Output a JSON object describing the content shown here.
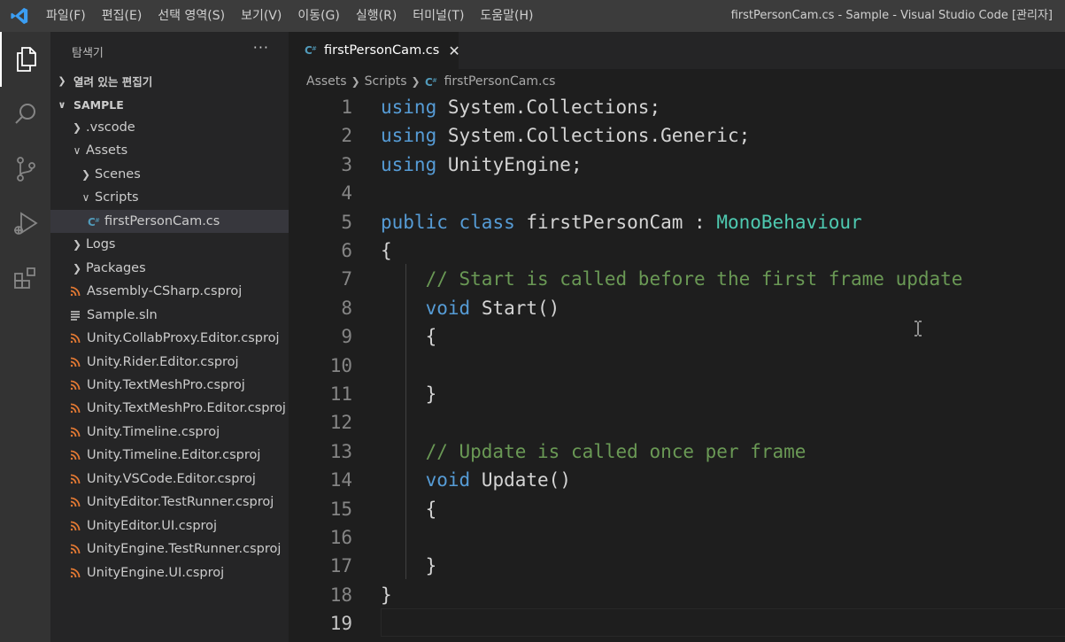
{
  "titlebar": {
    "menu": [
      "파일(F)",
      "편집(E)",
      "선택 영역(S)",
      "보기(V)",
      "이동(G)",
      "실행(R)",
      "터미널(T)",
      "도움말(H)"
    ],
    "window_title": "firstPersonCam.cs - Sample - Visual Studio Code [관리자]"
  },
  "activity_bar": {
    "icons": [
      "explorer-icon",
      "search-icon",
      "source-control-icon",
      "run-debug-icon",
      "extensions-icon"
    ],
    "active": "explorer-icon"
  },
  "sidebar": {
    "title": "탐색기",
    "more": "···",
    "open_editors_label": "열려 있는 편집기",
    "folder_label": "SAMPLE",
    "tree": [
      {
        "label": ".vscode",
        "kind": "folder",
        "expanded": false,
        "depth": 0
      },
      {
        "label": "Assets",
        "kind": "folder",
        "expanded": true,
        "depth": 0
      },
      {
        "label": "Scenes",
        "kind": "folder",
        "expanded": false,
        "depth": 1
      },
      {
        "label": "Scripts",
        "kind": "folder",
        "expanded": true,
        "depth": 1
      },
      {
        "label": "firstPersonCam.cs",
        "kind": "csharp",
        "depth": 2,
        "selected": true
      },
      {
        "label": "Logs",
        "kind": "folder",
        "expanded": false,
        "depth": 0
      },
      {
        "label": "Packages",
        "kind": "folder",
        "expanded": false,
        "depth": 0
      },
      {
        "label": "Assembly-CSharp.csproj",
        "kind": "rss",
        "depth": 0
      },
      {
        "label": "Sample.sln",
        "kind": "sln",
        "depth": 0
      },
      {
        "label": "Unity.CollabProxy.Editor.csproj",
        "kind": "rss",
        "depth": 0
      },
      {
        "label": "Unity.Rider.Editor.csproj",
        "kind": "rss",
        "depth": 0
      },
      {
        "label": "Unity.TextMeshPro.csproj",
        "kind": "rss",
        "depth": 0
      },
      {
        "label": "Unity.TextMeshPro.Editor.csproj",
        "kind": "rss",
        "depth": 0
      },
      {
        "label": "Unity.Timeline.csproj",
        "kind": "rss",
        "depth": 0
      },
      {
        "label": "Unity.Timeline.Editor.csproj",
        "kind": "rss",
        "depth": 0
      },
      {
        "label": "Unity.VSCode.Editor.csproj",
        "kind": "rss",
        "depth": 0
      },
      {
        "label": "UnityEditor.TestRunner.csproj",
        "kind": "rss",
        "depth": 0
      },
      {
        "label": "UnityEditor.UI.csproj",
        "kind": "rss",
        "depth": 0
      },
      {
        "label": "UnityEngine.TestRunner.csproj",
        "kind": "rss",
        "depth": 0
      },
      {
        "label": "UnityEngine.UI.csproj",
        "kind": "rss",
        "depth": 0
      }
    ]
  },
  "tab": {
    "label": "firstPersonCam.cs",
    "close": "✕"
  },
  "breadcrumb": [
    "Assets",
    "Scripts",
    "firstPersonCam.cs"
  ],
  "editor": {
    "active_line": 19,
    "lines": [
      [
        [
          "kw",
          "using"
        ],
        [
          "",
          "System.Collections;"
        ]
      ],
      [
        [
          "kw",
          "using"
        ],
        [
          "",
          "System.Collections.Generic;"
        ]
      ],
      [
        [
          "kw",
          "using"
        ],
        [
          "",
          "UnityEngine;"
        ]
      ],
      [],
      [
        [
          "kw",
          "public"
        ],
        [
          "kw",
          "class"
        ],
        [
          "",
          "firstPersonCam :"
        ],
        [
          "type",
          "MonoBehaviour"
        ]
      ],
      [
        [
          "",
          "{"
        ]
      ],
      [
        [
          "",
          "    "
        ],
        [
          "cmt",
          "// Start is called before the first frame update"
        ]
      ],
      [
        [
          "",
          "    "
        ],
        [
          "kw",
          "void"
        ],
        [
          "",
          "Start()"
        ]
      ],
      [
        [
          "",
          "    {"
        ]
      ],
      [],
      [
        [
          "",
          "    }"
        ]
      ],
      [],
      [
        [
          "",
          "    "
        ],
        [
          "cmt",
          "// Update is called once per frame"
        ]
      ],
      [
        [
          "",
          "    "
        ],
        [
          "kw",
          "void"
        ],
        [
          "",
          "Update()"
        ]
      ],
      [
        [
          "",
          "    {"
        ]
      ],
      [],
      [
        [
          "",
          "    }"
        ]
      ],
      [
        [
          "",
          "}"
        ]
      ],
      []
    ]
  },
  "colors": {
    "keyword": "#569cd6",
    "type": "#4ec9b0",
    "comment": "#6a9955",
    "rss_icon": "#e37933",
    "csharp_icon": "#519aba"
  }
}
